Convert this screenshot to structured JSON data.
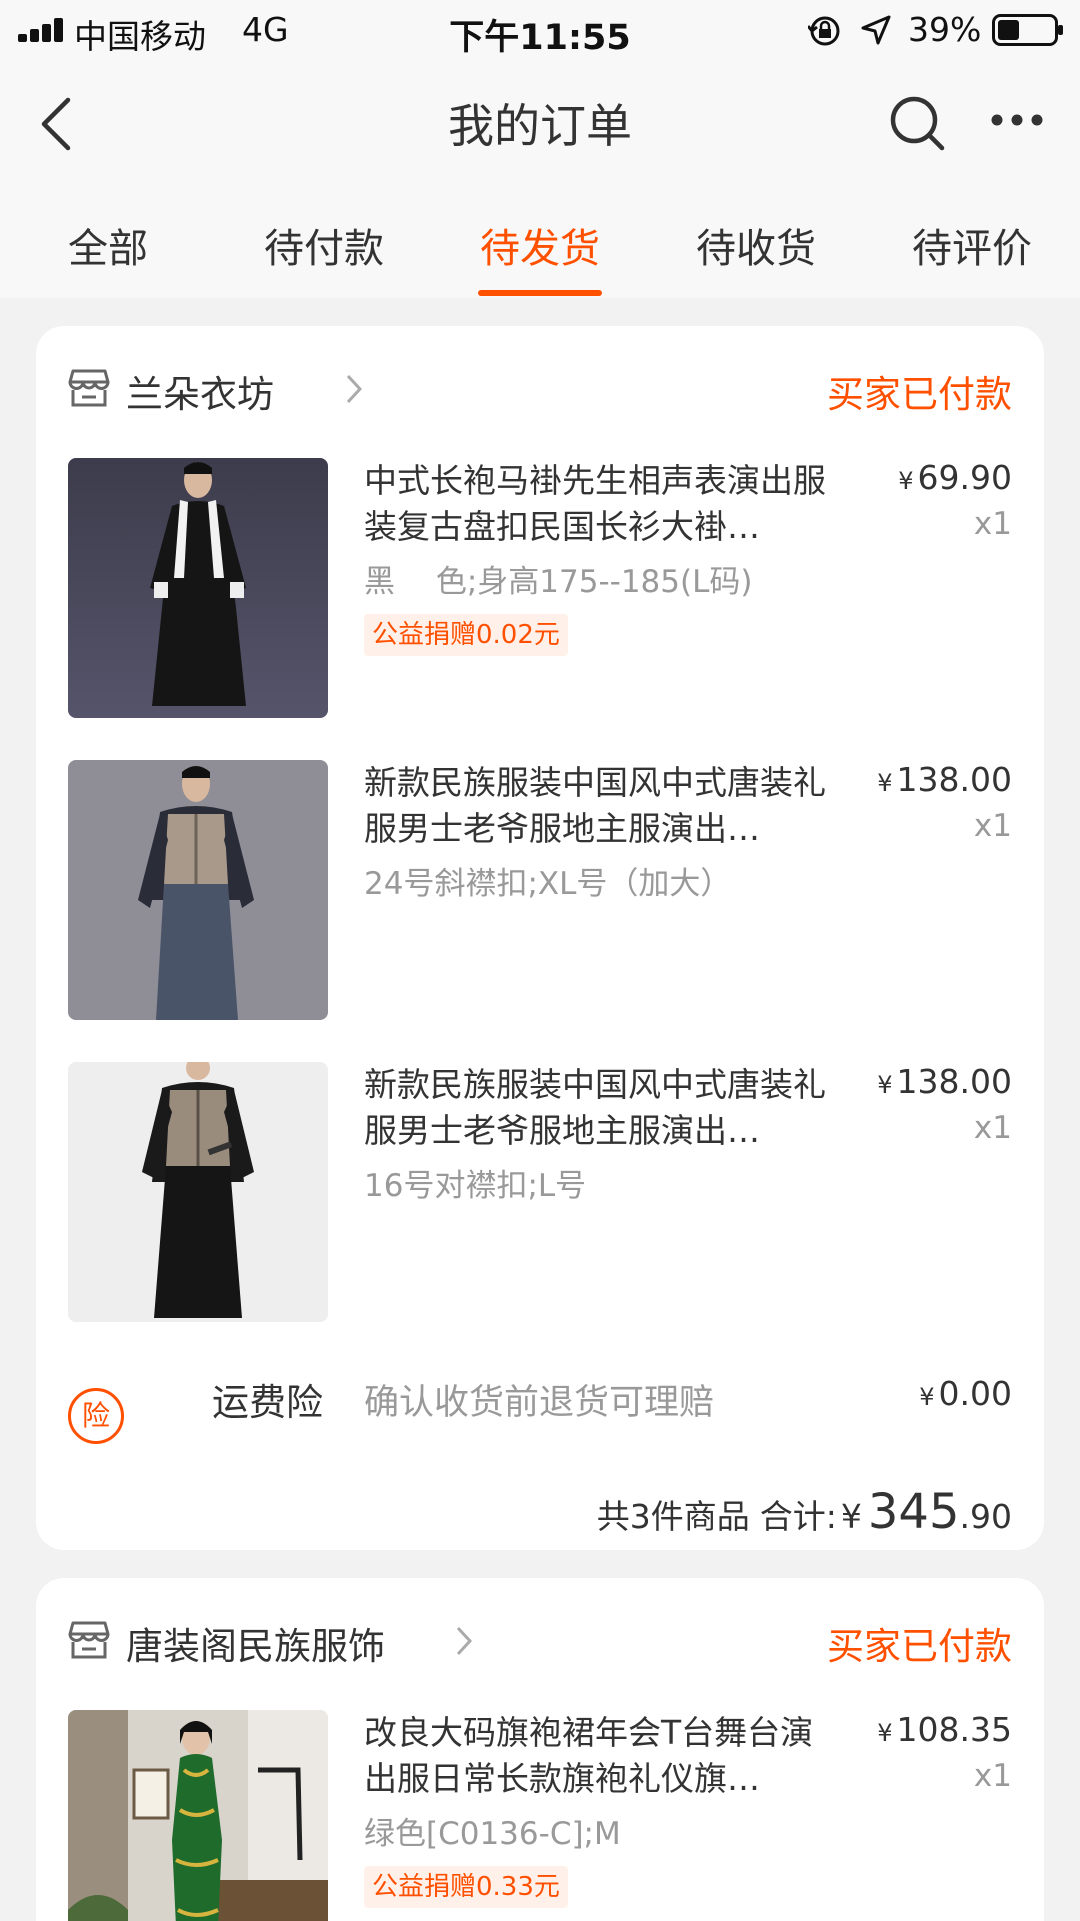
{
  "status_bar": {
    "carrier": "中国移动",
    "network": "4G",
    "time": "下午11:55",
    "battery": "39%",
    "battery_level": 0.39
  },
  "header": {
    "title": "我的订单",
    "back_icon": "chevron-left-icon",
    "search_icon": "search-icon",
    "more_icon": "more-icon"
  },
  "tabs": [
    {
      "label": "全部",
      "active": false
    },
    {
      "label": "待付款",
      "active": false
    },
    {
      "label": "待发货",
      "active": true
    },
    {
      "label": "待收货",
      "active": false
    },
    {
      "label": "待评价",
      "active": false
    }
  ],
  "colors": {
    "accent": "#ff5000",
    "background": "#f2f2f2",
    "card": "#ffffff",
    "secondary_text": "#999999"
  },
  "orders": [
    {
      "shop_name": "兰朵衣坊",
      "status": "买家已付款",
      "items": [
        {
          "title": "中式长袍马褂先生相声表演出服装复古盘扣民国长衫大褂…",
          "spec": "黑　 色;身高175--185(L码)",
          "price_symbol": "¥",
          "price": "69.90",
          "qty": "x1",
          "donation": "公益捐赠0.02元"
        },
        {
          "title": "新款民族服装中国风中式唐装礼服男士老爷服地主服演出…",
          "spec": "24号斜襟扣;XL号（加大）",
          "price_symbol": "¥",
          "price": "138.00",
          "qty": "x1"
        },
        {
          "title": "新款民族服装中国风中式唐装礼服男士老爷服地主服演出…",
          "spec": "16号对襟扣;L号",
          "price_symbol": "¥",
          "price": "138.00",
          "qty": "x1"
        }
      ],
      "insurance": {
        "badge": "险",
        "label": "运费险",
        "desc": "确认收货前退货可理赔",
        "price_symbol": "¥",
        "price": "0.00"
      },
      "total": {
        "count_text": "共3件商品",
        "label": "合计:",
        "symbol": "¥",
        "integer": "345",
        "decimal": ".90"
      }
    },
    {
      "shop_name": "唐装阁民族服饰",
      "status": "买家已付款",
      "items": [
        {
          "title": "改良大码旗袍裙年会T台舞台演出服日常长款旗袍礼仪旗…",
          "spec": "绿色[C0136-C];M",
          "price_symbol": "¥",
          "price": "108.35",
          "qty": "x1",
          "donation": "公益捐赠0.33元"
        }
      ]
    }
  ]
}
